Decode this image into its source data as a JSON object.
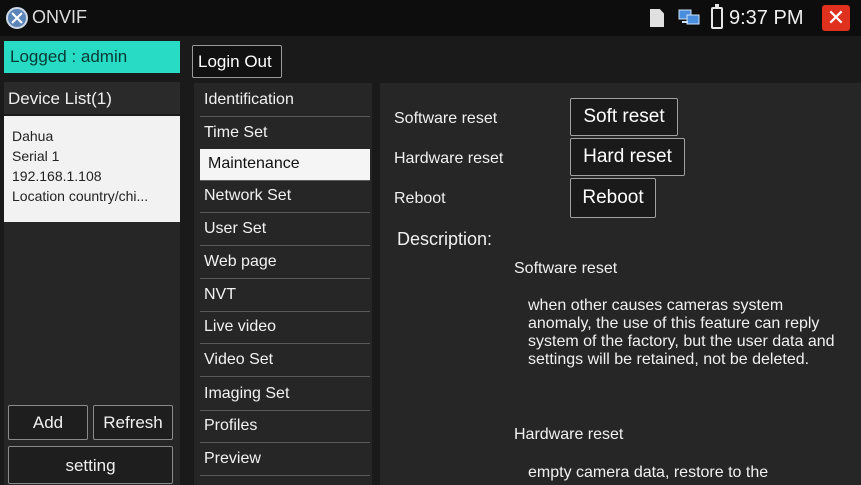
{
  "titlebar": {
    "app_title": "ONVIF",
    "time": "9:37 PM",
    "icons": [
      "onvif-app-icon",
      "sd-card-icon",
      "network-icon",
      "battery-icon",
      "close-icon"
    ]
  },
  "session": {
    "logged_label": "Logged : admin",
    "login_out_label": "Login Out"
  },
  "device_list": {
    "title": "Device List(1)",
    "devices": [
      {
        "name": "Dahua",
        "serial": "Serial 1",
        "ip": "192.168.1.108",
        "location": "Location country/chi..."
      }
    ]
  },
  "left_buttons": {
    "add": "Add",
    "refresh": "Refresh",
    "setting": "setting"
  },
  "menu": {
    "items": [
      "Identification",
      "Time Set",
      "Maintenance",
      "Network Set",
      "User Set",
      "Web page",
      "NVT",
      "Live video",
      "Video Set",
      "Imaging Set",
      "Profiles",
      "Preview"
    ],
    "selected": "Maintenance"
  },
  "maintenance": {
    "rows": [
      {
        "label": "Software reset",
        "button": "Soft reset"
      },
      {
        "label": "Hardware reset",
        "button": "Hard reset"
      },
      {
        "label": "Reboot",
        "button": "Reboot"
      }
    ],
    "description_title": "Description:",
    "software_reset_title": "Software reset",
    "software_reset_text": "when other causes cameras system anomaly, the use of this feature can reply system of the factory, but the user data and settings will be retained, not be deleted.",
    "hardware_reset_title": "Hardware reset",
    "hardware_reset_text": "empty camera data, restore to the"
  },
  "colors": {
    "accent_logged": "#27dbc4",
    "close_red": "#e0301e",
    "panel_bg": "#262626"
  }
}
